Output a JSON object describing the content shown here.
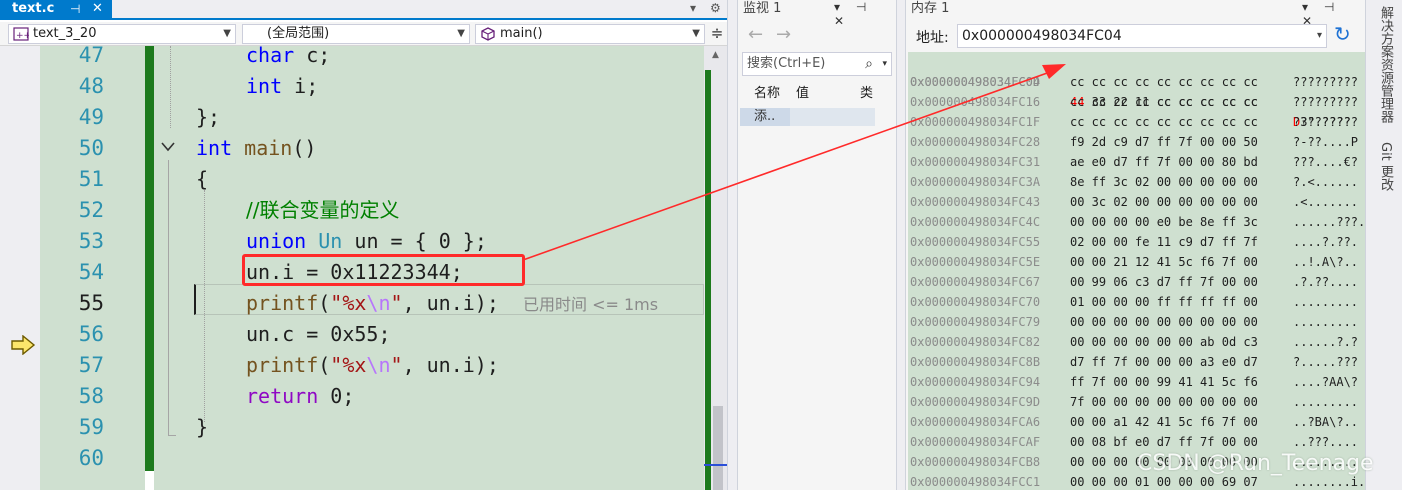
{
  "editor": {
    "tab_title": "text.c",
    "tab_pin": "⊣",
    "tab_close": "✕",
    "tabbar_dropdown": "▾",
    "tabbar_gear": "⚙",
    "nav_project": "text_3_20",
    "nav_scope": "(全局范围)",
    "nav_function": "main()",
    "split_icon": "≑",
    "line_numbers": [
      "47",
      "48",
      "49",
      "50",
      "51",
      "52",
      "53",
      "54",
      "55",
      "56",
      "57",
      "58",
      "59",
      "60"
    ],
    "code_lines": {
      "l47": {
        "kw": "char",
        "rest": " c;"
      },
      "l48": {
        "kw": "int",
        "rest": " i;"
      },
      "l49": {
        "text": "};"
      },
      "l50": {
        "kw": "int",
        "fn": "main",
        "rest": "()"
      },
      "l51": {
        "text": "{"
      },
      "l52": {
        "comment": "//联合变量的定义"
      },
      "l53": {
        "kw": "union",
        "type": "Un",
        "var": "un",
        "rest": " = { 0 };"
      },
      "l54": {
        "var": "un",
        "rest": ".i = 0x11223344;"
      },
      "l55": {
        "fn": "printf",
        "open": "(",
        "str1": "\"%x",
        "esc": "\\n",
        "str2": "\"",
        "rest": ", un.i);",
        "hint": "已用时间 <= 1ms"
      },
      "l56": {
        "var": "un",
        "rest": ".c = 0x55;"
      },
      "l57": {
        "fn": "printf",
        "open": "(",
        "str1": "\"%x",
        "esc": "\\n",
        "str2": "\"",
        "rest": ", un.i);"
      },
      "l58": {
        "kw": "return",
        "rest": " 0;"
      },
      "l59": {
        "text": "}"
      },
      "l60": {
        "text": ""
      }
    }
  },
  "watch": {
    "title": "监视 1",
    "controls": "▾ ⊣ ✕",
    "back": "←",
    "forward": "→",
    "search_placeholder": "搜索(Ctrl+E)",
    "search_icon": "⌕",
    "search_dropdown": "▾",
    "col_name": "名称",
    "col_value": "值",
    "col_type": "类",
    "add_row": "添.."
  },
  "memory": {
    "title": "内存 1",
    "controls": "▾ ⊣ ✕",
    "address_label": "地址:",
    "address_value": "0x000000498034FC04",
    "address_dropdown": "▾",
    "refresh_icon": "↻",
    "first_row": {
      "addr": "0x000000498034FC04",
      "hi": "44",
      "bytes_rest": " 33 22 11 cc cc cc cc cc",
      "ascii_hi": "D",
      "ascii_rest": "3\".????"
    },
    "rows": [
      {
        "addr": "0x000000498034FC0D",
        "bytes": "cc cc cc cc cc cc cc cc cc",
        "ascii": "?????????"
      },
      {
        "addr": "0x000000498034FC16",
        "bytes": "cc cc cc cc cc cc cc cc cc",
        "ascii": "?????????"
      },
      {
        "addr": "0x000000498034FC1F",
        "bytes": "cc cc cc cc cc cc cc cc cc",
        "ascii": "?????????"
      },
      {
        "addr": "0x000000498034FC28",
        "bytes": "f9 2d c9 d7 ff 7f 00 00 50",
        "ascii": "?-??....P"
      },
      {
        "addr": "0x000000498034FC31",
        "bytes": "ae e0 d7 ff 7f 00 00 80 bd",
        "ascii": "???....€?"
      },
      {
        "addr": "0x000000498034FC3A",
        "bytes": "8e ff 3c 02 00 00 00 00 00",
        "ascii": "?.<......"
      },
      {
        "addr": "0x000000498034FC43",
        "bytes": "00 3c 02 00 00 00 00 00 00",
        "ascii": ".<......."
      },
      {
        "addr": "0x000000498034FC4C",
        "bytes": "00 00 00 00 e0 be 8e ff 3c",
        "ascii": "......???.<"
      },
      {
        "addr": "0x000000498034FC55",
        "bytes": "02 00 00 fe 11 c9 d7 ff 7f",
        "ascii": "....?.??."
      },
      {
        "addr": "0x000000498034FC5E",
        "bytes": "00 00 21 12 41 5c f6 7f 00",
        "ascii": "..!.A\\?.."
      },
      {
        "addr": "0x000000498034FC67",
        "bytes": "00 99 06 c3 d7 ff 7f 00 00",
        "ascii": ".?.??...."
      },
      {
        "addr": "0x000000498034FC70",
        "bytes": "01 00 00 00 ff ff ff ff 00",
        "ascii": "........."
      },
      {
        "addr": "0x000000498034FC79",
        "bytes": "00 00 00 00 00 00 00 00 00",
        "ascii": "........."
      },
      {
        "addr": "0x000000498034FC82",
        "bytes": "00 00 00 00 00 00 ab 0d c3",
        "ascii": "......?.?"
      },
      {
        "addr": "0x000000498034FC8B",
        "bytes": "d7 ff 7f 00 00 00 a3 e0 d7",
        "ascii": "?.....???"
      },
      {
        "addr": "0x000000498034FC94",
        "bytes": "ff 7f 00 00 99 41 41 5c f6",
        "ascii": "....?AA\\?"
      },
      {
        "addr": "0x000000498034FC9D",
        "bytes": "7f 00 00 00 00 00 00 00 00",
        "ascii": "........."
      },
      {
        "addr": "0x000000498034FCA6",
        "bytes": "00 00 a1 42 41 5c f6 7f 00",
        "ascii": "..?BA\\?.."
      },
      {
        "addr": "0x000000498034FCAF",
        "bytes": "00 08 bf e0 d7 ff 7f 00 00",
        "ascii": "..???...."
      },
      {
        "addr": "0x000000498034FCB8",
        "bytes": "00 00 00 00 00 00 00 00 00",
        "ascii": "........."
      },
      {
        "addr": "0x000000498034FCC1",
        "bytes": "00 00 00 01 00 00 00 69 07",
        "ascii": "........i."
      }
    ]
  },
  "side_strip": {
    "tab1": "解决方案资源管理器",
    "tab2": "Git 更改"
  },
  "watermark": "CSDN @Run_Teenage",
  "colors": {
    "accent": "#007acc",
    "code_bg": "#cfe0d0",
    "change_bar": "#1d7a1d",
    "annotation_red": "#ff2a2a"
  }
}
